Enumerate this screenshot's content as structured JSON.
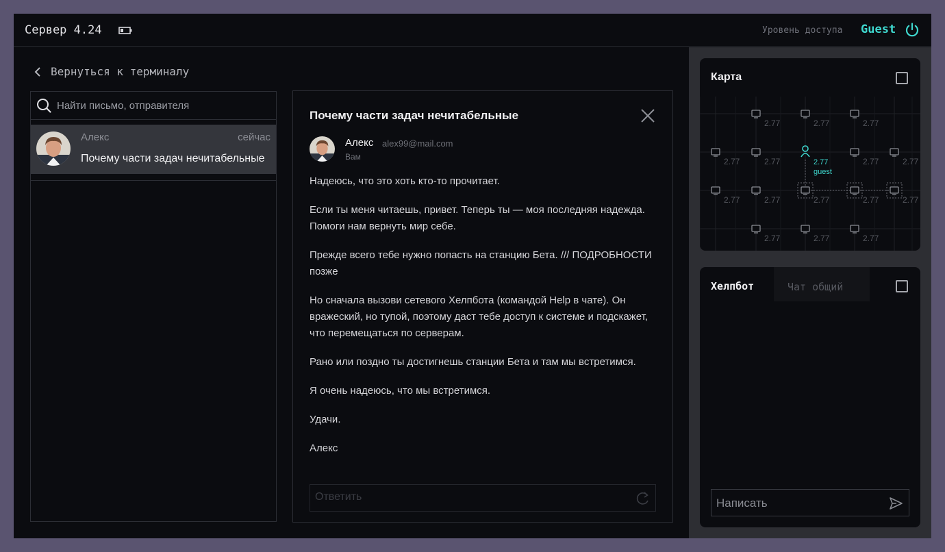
{
  "header": {
    "server_title": "Сервер 4.24",
    "access_label": "Уровень доступа",
    "access_value": "Guest",
    "accent_color": "#3fd8cf"
  },
  "back_link": {
    "label": "Вернуться к терминалу"
  },
  "search": {
    "placeholder": "Найти письмо, отправителя"
  },
  "mail_list": {
    "items": [
      {
        "sender": "Алекс",
        "time": "сейчас",
        "subject": "Почему части задач нечитабельные"
      }
    ]
  },
  "message": {
    "subject": "Почему части задач нечитабельные",
    "sender": "Алекс",
    "email": "alex99@mail.com",
    "to": "Вам",
    "paragraphs": [
      "Надеюсь, что это хоть кто-то прочитает.",
      "Если ты меня читаешь, привет. Теперь ты — моя последняя надежда. Помоги нам вернуть мир себе.",
      "Прежде всего тебе нужно попасть на станцию Бета. /// ПОДРОБНОСТИ позже",
      "Но сначала вызови сетевого Хелпбота (командой Help в чате). Он вражеский, но тупой, поэтому даст тебе доступ к системе и подскажет, что перемещаться по серверам.",
      "Рано или поздно ты достигнешь станции Бета и там мы встретимся.",
      "Я очень надеюсь, что мы встретимся.",
      "Удачи.",
      "Алекс"
    ],
    "reply_placeholder": "Ответить"
  },
  "map": {
    "title": "Карта",
    "node_value": "2.77",
    "player_value": "2.77",
    "player_label": "guest"
  },
  "chat": {
    "tab_active": "Хелпбот",
    "tab_inactive": "Чат общий",
    "input_placeholder": "Написать"
  }
}
